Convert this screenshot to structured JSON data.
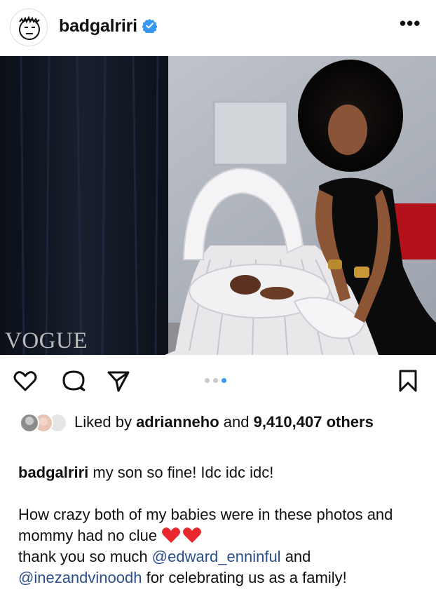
{
  "post": {
    "username": "badgalriri",
    "verified": true,
    "more_icon": "more-horizontal-icon",
    "more_label": "•••"
  },
  "image": {
    "watermark": "VOGUE",
    "carousel": {
      "count": 3,
      "active_index": 2
    }
  },
  "actions": {
    "icons": [
      "heart-icon",
      "comment-icon",
      "share-icon",
      "bookmark-icon"
    ]
  },
  "likes": {
    "prefix": "Liked by ",
    "user": "adrianneho",
    "middle": " and ",
    "count": "9,410,407",
    "suffix": " others"
  },
  "caption": {
    "username": "badgalriri",
    "line1": " my son so fine! Idc idc idc!",
    "para2_text1": "How crazy both of my babies were in these photos and mommy had no clue ",
    "para2_text2": "thank you so much ",
    "mention1": "@edward_enninful",
    "para2_text3": " and ",
    "mention2": "@inezandvinoodh",
    "para2_text4": " for celebrating us as a family!",
    "emoji": [
      "red-heart-icon",
      "red-heart-icon"
    ]
  },
  "colors": {
    "verified_blue": "#3897f0",
    "heart_red": "#e8282e",
    "mention_blue": "#2b4f8c",
    "carousel_active": "#3897f0"
  }
}
